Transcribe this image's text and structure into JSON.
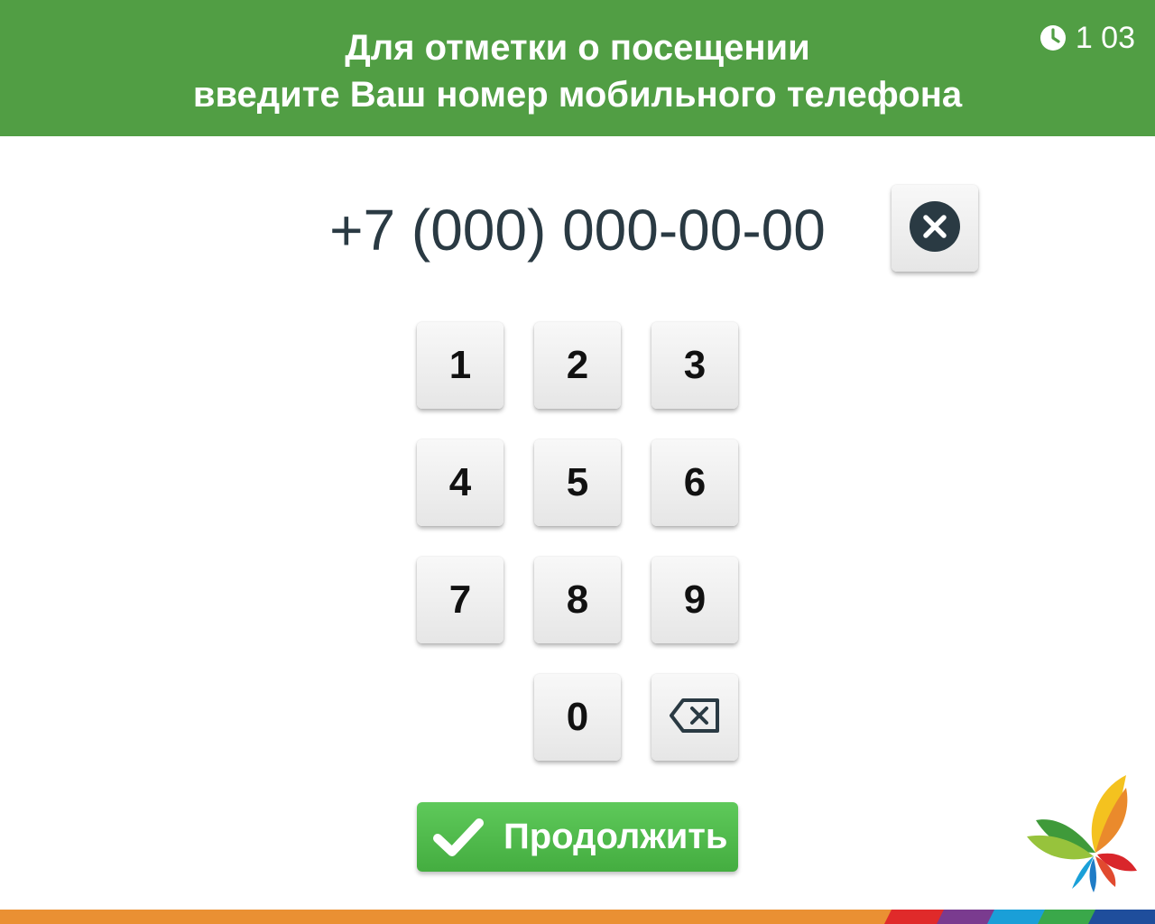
{
  "header": {
    "title_line1": "Для отметки о посещении",
    "title_line2": "введите Ваш номер мобильного телефона",
    "timer": "1 03",
    "timer_icon": "clock-icon",
    "background": "#519e44"
  },
  "phone": {
    "value": "+7 (000) 000-00-00",
    "clear_icon": "close-circle-icon"
  },
  "keypad": {
    "k1": "1",
    "k2": "2",
    "k3": "3",
    "k4": "4",
    "k5": "5",
    "k6": "6",
    "k7": "7",
    "k8": "8",
    "k9": "9",
    "k0": "0",
    "backspace_icon": "backspace-icon"
  },
  "continue_button": {
    "label": "Продолжить",
    "icon": "checkmark-icon",
    "color": "#4cb848"
  },
  "logo": {
    "icon": "butterfly-logo-icon"
  },
  "footer": {
    "bar_color": "#ea9033",
    "stripe_colors": [
      "#e02a2a",
      "#7a3b8f",
      "#1a9fd8",
      "#3aa84a",
      "#1f4e9c"
    ]
  }
}
